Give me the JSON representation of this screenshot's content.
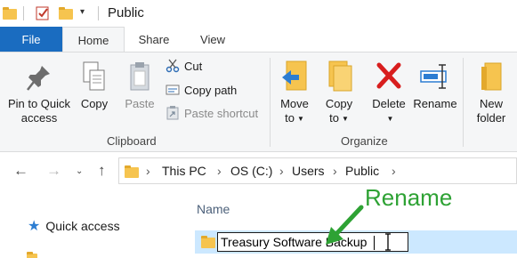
{
  "window": {
    "title": "Public"
  },
  "tabs": [
    {
      "label": "File"
    },
    {
      "label": "Home"
    },
    {
      "label": "Share"
    },
    {
      "label": "View"
    }
  ],
  "ribbon": {
    "clipboard": {
      "pin_label_1": "Pin to Quick",
      "pin_label_2": "access",
      "copy": "Copy",
      "paste": "Paste",
      "cut": "Cut",
      "copy_path": "Copy path",
      "paste_shortcut": "Paste shortcut",
      "group": "Clipboard"
    },
    "organize": {
      "move_to_1": "Move",
      "move_to_2": "to",
      "copy_to_1": "Copy",
      "copy_to_2": "to",
      "delete": "Delete",
      "rename": "Rename",
      "group": "Organize"
    },
    "new": {
      "new_folder_1": "New",
      "new_folder_2": "folder"
    }
  },
  "address": {
    "crumbs": [
      "This PC",
      "OS (C:)",
      "Users",
      "Public"
    ]
  },
  "nav": {
    "quick_access": "Quick access"
  },
  "list": {
    "column_name": "Name",
    "rename_value": "Treasury Software Backup"
  },
  "annotation": {
    "text": "Rename"
  },
  "colors": {
    "accent": "#1a6cc0",
    "selection": "#cce8ff",
    "annotation": "#2ea234",
    "delete_red": "#d81e1e",
    "folder": "#f6c44f"
  }
}
